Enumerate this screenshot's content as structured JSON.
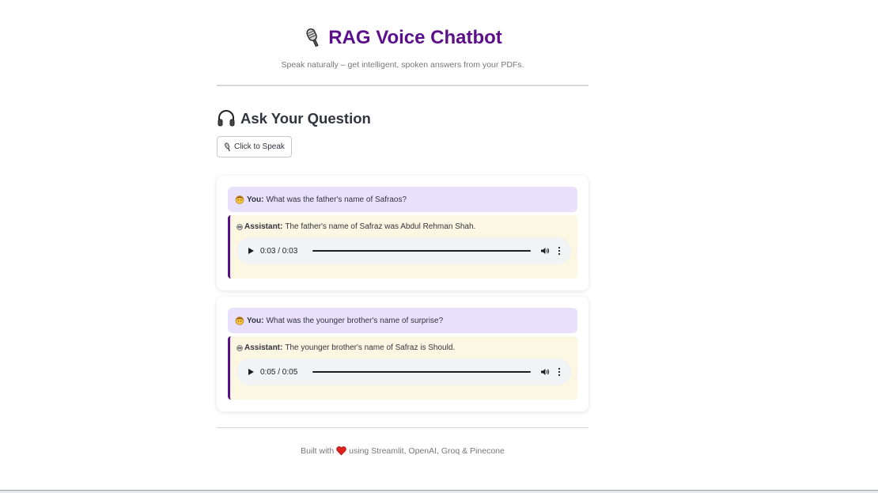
{
  "header": {
    "title": "RAG Voice Chatbot",
    "subtitle": "Speak naturally – get intelligent, spoken answers from your PDFs.",
    "title_color": "#5c0f8b"
  },
  "section": {
    "title": "Ask Your Question",
    "speak_button_label": "Click to Speak"
  },
  "conversation": [
    {
      "user_label": "You:",
      "user_text": "What was the father's name of Safraos?",
      "assistant_label": "Assistant:",
      "assistant_text": "The father's name of Safraz was Abdul Rehman Shah.",
      "audio_time": "0:03 / 0:03"
    },
    {
      "user_label": "You:",
      "user_text": "What was the younger brother's name of surprise?",
      "assistant_label": "Assistant:",
      "assistant_text": "The younger brother's name of Safraz is Should.",
      "audio_time": "0:05 / 0:05"
    }
  ],
  "footer": {
    "prefix": "Built with",
    "suffix": "using Streamlit, OpenAI, Groq & Pinecone"
  },
  "icons": {
    "title": "microphone-icon",
    "section": "headphones-icon",
    "button": "microphone-icon",
    "user": "person-icon",
    "assistant": "robot-icon",
    "footer": "heart-icon"
  },
  "colors": {
    "accent": "#5c0f8b",
    "user_bubble": "#e9e1fb",
    "assistant_bubble": "#fcf7e3",
    "heart": "#e0201b"
  }
}
